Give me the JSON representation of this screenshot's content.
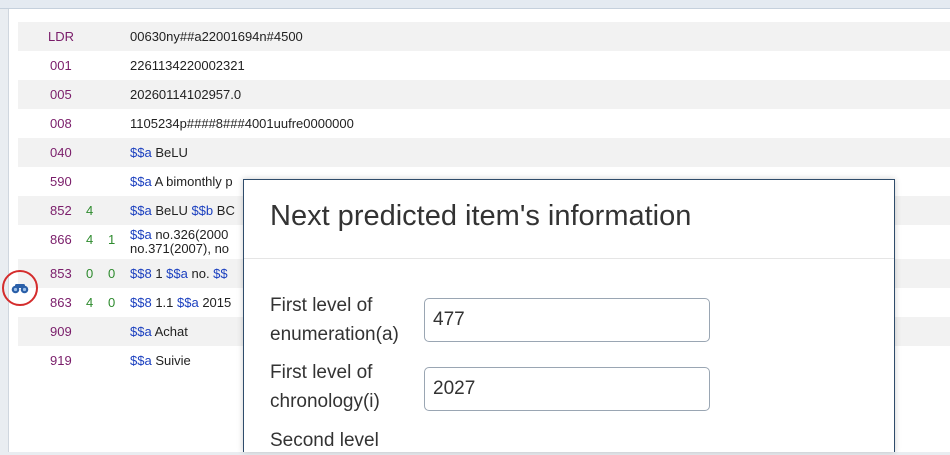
{
  "records": [
    {
      "tag": "LDR",
      "ind1": "",
      "ind2": "",
      "segments": [
        {
          "t": "00630ny##a22001694n#4500"
        }
      ]
    },
    {
      "tag": "001",
      "ind1": "",
      "ind2": "",
      "segments": [
        {
          "t": "2261134220002321"
        }
      ]
    },
    {
      "tag": "005",
      "ind1": "",
      "ind2": "",
      "segments": [
        {
          "t": "20260114102957.0"
        }
      ]
    },
    {
      "tag": "008",
      "ind1": "",
      "ind2": "",
      "segments": [
        {
          "t": "1105234p####8###4001uufre0000000"
        }
      ]
    },
    {
      "tag": "040",
      "ind1": "",
      "ind2": "",
      "segments": [
        {
          "t": "$$a",
          "sf": true
        },
        {
          "t": " BeLU"
        }
      ]
    },
    {
      "tag": "590",
      "ind1": "",
      "ind2": "",
      "segments": [
        {
          "t": "$$a",
          "sf": true
        },
        {
          "t": " A bimonthly p"
        }
      ]
    },
    {
      "tag": "852",
      "ind1": "4",
      "ind2": "",
      "segments": [
        {
          "t": "$$a",
          "sf": true
        },
        {
          "t": " BeLU "
        },
        {
          "t": "$$b",
          "sf": true
        },
        {
          "t": " BC"
        }
      ]
    },
    {
      "tag": "866",
      "ind1": "4",
      "ind2": "1",
      "tall": true,
      "segments": [
        {
          "t": "$$a",
          "sf": true
        },
        {
          "t": " no.326(2000"
        }
      ],
      "line2": "no.371(2007), no"
    },
    {
      "tag": "853",
      "ind1": "0",
      "ind2": "0",
      "segments": [
        {
          "t": "$$8",
          "sf": true
        },
        {
          "t": " 1 "
        },
        {
          "t": "$$a",
          "sf": true
        },
        {
          "t": " no. "
        },
        {
          "t": "$$",
          "sf": true
        }
      ]
    },
    {
      "tag": "863",
      "ind1": "4",
      "ind2": "0",
      "segments": [
        {
          "t": "$$8",
          "sf": true
        },
        {
          "t": " 1.1 "
        },
        {
          "t": "$$a",
          "sf": true
        },
        {
          "t": " 2015"
        }
      ]
    },
    {
      "tag": "909",
      "ind1": "",
      "ind2": "",
      "segments": [
        {
          "t": "$$a",
          "sf": true
        },
        {
          "t": " Achat"
        }
      ]
    },
    {
      "tag": "919",
      "ind1": "",
      "ind2": "",
      "segments": [
        {
          "t": "$$a",
          "sf": true
        },
        {
          "t": " Suivie"
        }
      ]
    }
  ],
  "dialog": {
    "title": "Next predicted item's information",
    "fields": [
      {
        "label": "First level of enumeration(a)",
        "value": "477"
      },
      {
        "label": "First level of chronology(i)",
        "value": "2027"
      },
      {
        "label": "Second level",
        "value": ""
      }
    ]
  },
  "icons": {
    "predict": "binoculars-icon"
  },
  "colors": {
    "tag": "#7a1d6a",
    "indicator": "#2e8b2e",
    "subfield": "#1a3fbf",
    "highlight_ring": "#d42c2c",
    "dialog_border": "#2f4c6b"
  }
}
